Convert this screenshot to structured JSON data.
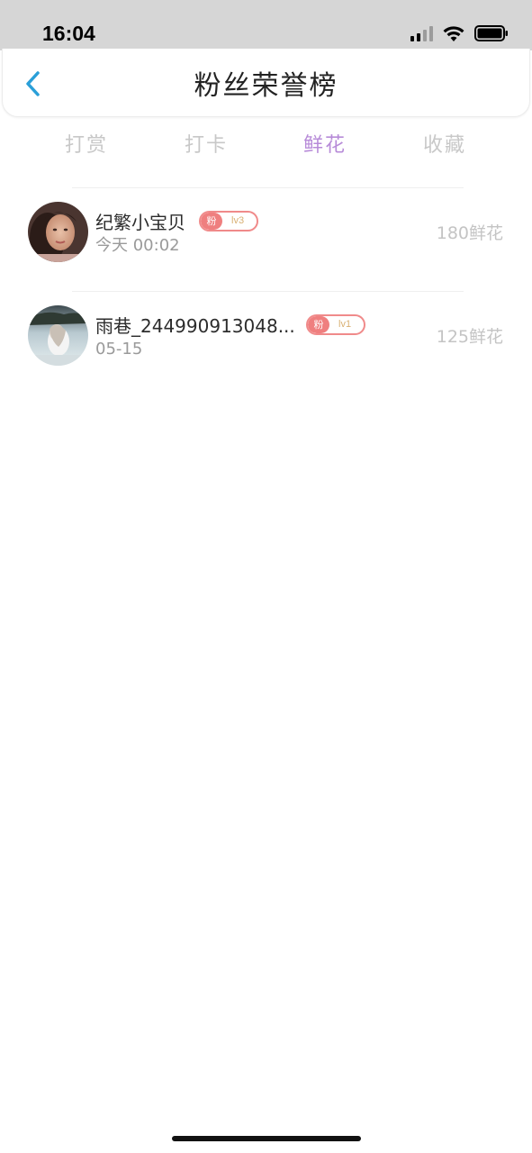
{
  "status_bar": {
    "time": "16:04"
  },
  "nav": {
    "title": "粉丝荣誉榜",
    "back_icon": "chevron-left-icon",
    "accent_color": "#2a9fd8"
  },
  "tabs": [
    {
      "label": "打赏",
      "active": false
    },
    {
      "label": "打卡",
      "active": false
    },
    {
      "label": "鲜花",
      "active": true
    },
    {
      "label": "收藏",
      "active": false
    }
  ],
  "colors": {
    "active_tab": "#b78bd8",
    "inactive_tab": "#c8c8c8",
    "badge_border": "#f08a8a",
    "badge_level_text": "#d9b073"
  },
  "fans": [
    {
      "name": "纪繁小宝贝",
      "badge_label": "粉",
      "level": "lv3",
      "time": "今天 00:02",
      "amount": "180鲜花"
    },
    {
      "name": "雨巷_244990913048...",
      "badge_label": "粉",
      "level": "lv1",
      "time": "05-15",
      "amount": "125鲜花"
    }
  ]
}
